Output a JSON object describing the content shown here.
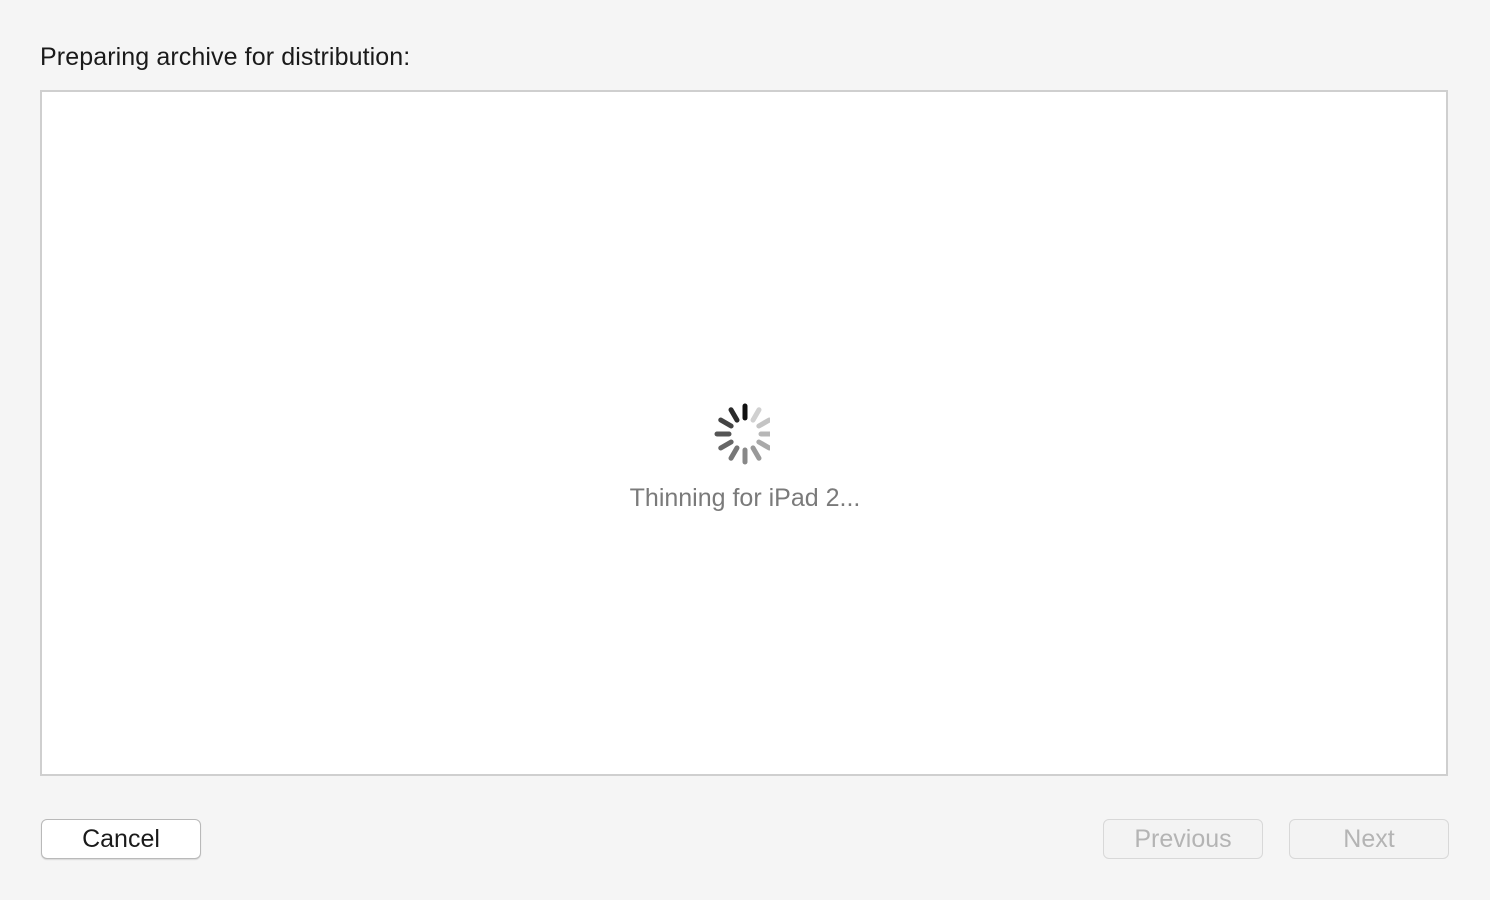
{
  "dialog": {
    "heading": "Preparing archive for distribution:",
    "status_text": "Thinning for iPad 2...",
    "spinner_icon": "loading-spinner-icon"
  },
  "buttons": {
    "cancel_label": "Cancel",
    "previous_label": "Previous",
    "next_label": "Next",
    "previous_enabled": false,
    "next_enabled": false
  },
  "colors": {
    "window_background": "#f5f5f5",
    "content_background": "#ffffff",
    "status_text": "#7a7a7a",
    "disabled_text": "#b4b4b4"
  }
}
